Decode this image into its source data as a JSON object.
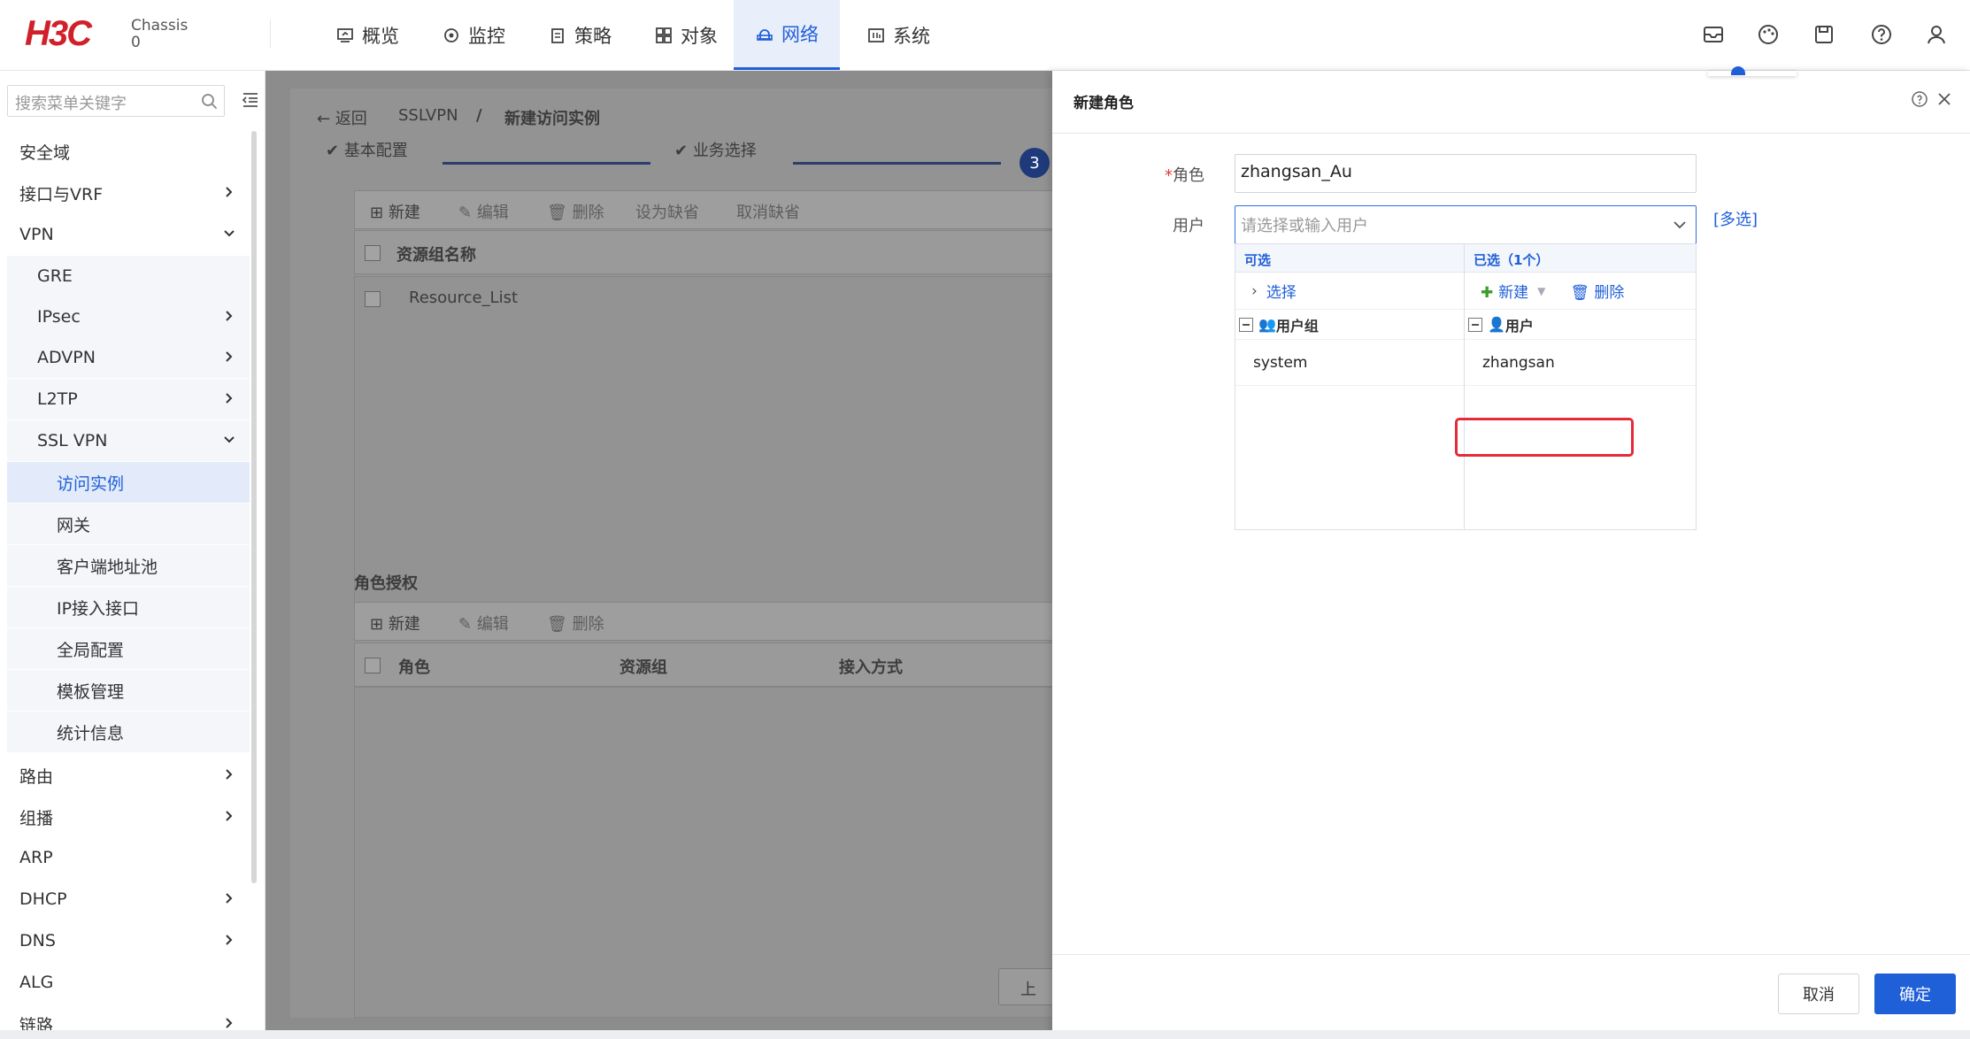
{
  "header": {
    "brand": "H3C",
    "chassis_label": "Chassis",
    "chassis_num": "0",
    "nav": [
      {
        "label": "概览",
        "icon": "monitor-icon"
      },
      {
        "label": "监控",
        "icon": "target-icon"
      },
      {
        "label": "策略",
        "icon": "clipboard-icon"
      },
      {
        "label": "对象",
        "icon": "grid-icon"
      },
      {
        "label": "网络",
        "icon": "network-icon",
        "active": true
      },
      {
        "label": "系统",
        "icon": "system-icon"
      }
    ]
  },
  "sidebar": {
    "search_placeholder": "搜索菜单关键字",
    "items": [
      {
        "label": "安全域"
      },
      {
        "label": "接口与VRF"
      },
      {
        "label": "VPN"
      },
      {
        "label": "GRE"
      },
      {
        "label": "IPsec"
      },
      {
        "label": "ADVPN"
      },
      {
        "label": "L2TP"
      },
      {
        "label": "SSL VPN"
      },
      {
        "label": "访问实例"
      },
      {
        "label": "网关"
      },
      {
        "label": "客户端地址池"
      },
      {
        "label": "IP接入接口"
      },
      {
        "label": "全局配置"
      },
      {
        "label": "模板管理"
      },
      {
        "label": "统计信息"
      },
      {
        "label": "路由"
      },
      {
        "label": "组播"
      },
      {
        "label": "ARP"
      },
      {
        "label": "DHCP"
      },
      {
        "label": "DNS"
      },
      {
        "label": "ALG"
      },
      {
        "label": "链路"
      }
    ]
  },
  "main": {
    "back": "返回",
    "crumb1": "SSLVPN",
    "crumb_sep": "/",
    "crumb2": "新建访问实例",
    "step1": "基本配置",
    "step2": "业务选择",
    "step3": "3",
    "toolbar": {
      "new": "新建",
      "edit": "编辑",
      "delete": "删除",
      "set_default": "设为缺省",
      "cancel_default": "取消缺省"
    },
    "table1_header": "资源组名称",
    "table1_row": "Resource_List",
    "section2": "角色授权",
    "table2_cols": [
      "角色",
      "资源组",
      "接入方式"
    ],
    "prev_btn": "上"
  },
  "drawer": {
    "title": "新建角色",
    "role_label": "角色",
    "role_value": "zhangsan_Au",
    "user_label": "用户",
    "user_placeholder": "请选择或输入用户",
    "multi_link": "[多选]",
    "available_header": "可选",
    "selected_header": "已选（1个）",
    "select_link": "选择",
    "new_label": "新建",
    "delete_label": "删除",
    "group_col": "用户组",
    "user_col": "用户",
    "available_item": "system",
    "selected_item": "zhangsan",
    "cancel": "取消",
    "ok": "确定"
  }
}
